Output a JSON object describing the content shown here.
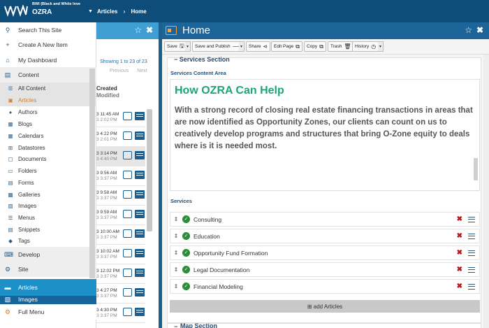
{
  "topbar": {
    "org_subtitle": "BWI (Black and White Inve",
    "org_name": "OZRA",
    "breadcrumbs": [
      "Articles",
      "Home"
    ]
  },
  "menu": {
    "items": [
      {
        "label": "Search This Site",
        "icon": "search-icon"
      },
      {
        "label": "Create A New Item",
        "icon": "plus-icon"
      },
      {
        "label": "My Dashboard",
        "icon": "home-icon"
      },
      {
        "label": "Content",
        "icon": "file-icon"
      }
    ],
    "content_sub": [
      {
        "label": "All Content",
        "icon": "list-icon"
      },
      {
        "label": "Articles",
        "icon": "article-icon"
      },
      {
        "label": "Authors",
        "icon": "user-icon"
      },
      {
        "label": "Blogs",
        "icon": "book-icon"
      },
      {
        "label": "Calendars",
        "icon": "calendar-icon"
      },
      {
        "label": "Datastores",
        "icon": "grid-icon"
      },
      {
        "label": "Documents",
        "icon": "document-icon"
      },
      {
        "label": "Folders",
        "icon": "folder-icon"
      },
      {
        "label": "Forms",
        "icon": "form-icon"
      },
      {
        "label": "Galleries",
        "icon": "gallery-icon"
      },
      {
        "label": "Images",
        "icon": "image-icon"
      },
      {
        "label": "Menus",
        "icon": "menu-icon"
      },
      {
        "label": "Snippets",
        "icon": "snippet-icon"
      },
      {
        "label": "Tags",
        "icon": "tag-icon"
      }
    ],
    "develop": "Develop",
    "site": "Site",
    "articles_active": "Articles",
    "images_partial": "Images",
    "full_menu": "Full Menu"
  },
  "listing": {
    "showing": "Showing 1 to 23 of 23",
    "previous": "Previous",
    "next": "Next",
    "col_created": "Created",
    "col_modified": "Modified",
    "rows": [
      {
        "created": "3 11:45 AM",
        "modified": "3 2:02 PM"
      },
      {
        "created": "3 4:22 PM",
        "modified": "3 2:01 PM"
      },
      {
        "created": "3 3:14 PM",
        "modified": "3 4:40 PM"
      },
      {
        "created": "3 9:56 AM",
        "modified": "3 3:37 PM"
      },
      {
        "created": "3 9:58 AM",
        "modified": "3 3:37 PM"
      },
      {
        "created": "3 9:59 AM",
        "modified": "3 3:37 PM"
      },
      {
        "created": "3 10:00 AM",
        "modified": "3 3:37 PM"
      },
      {
        "created": "3 10:02 AM",
        "modified": "3 3:37 PM"
      },
      {
        "created": "3 12:02 PM",
        "modified": "3 3:37 PM"
      },
      {
        "created": "3 4:27 PM",
        "modified": "3 3:37 PM"
      },
      {
        "created": "3 4:30 PM",
        "modified": "3 3:37 PM"
      }
    ]
  },
  "editor_panel": {
    "title": "Home",
    "toolbar": {
      "save": "Save",
      "save_publish": "Save and Publish",
      "share": "Share",
      "edit_page": "Edit Page",
      "copy": "Copy",
      "trash": "Trash",
      "history": "History"
    },
    "section_title": "Services Section",
    "content_area_label": "Services Content Area",
    "heading": "How OZRA Can Help",
    "body": "With a strong record of closing real estate financing transactions in areas that are now identified as Opportunity Zones, our clients can count on us to creatively develop programs and structures that bring O-Zone equity to deals where is it is needed most.",
    "services_label": "Services",
    "services": [
      "Consulting",
      "Education",
      "Opportunity Fund Formation",
      "Legal Documentation",
      "Financial Modeling"
    ],
    "add_articles": "add Articles",
    "map_section": "Map Section"
  },
  "colors": {
    "topbar": "#0e4d7a",
    "accent_blue": "#1e90c8",
    "heading_green": "#1ba67a",
    "delete_red": "#b31b1b",
    "active_orange": "#e07a1a"
  }
}
